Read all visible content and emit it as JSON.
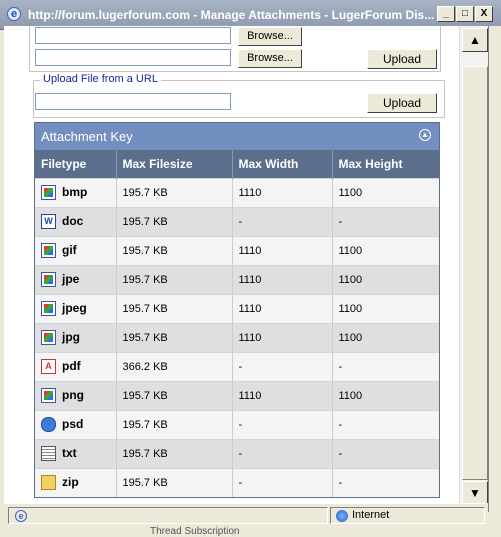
{
  "window": {
    "title": "http://forum.lugerforum.com - Manage Attachments - LugerForum Dis...",
    "controls": [
      "_",
      "□",
      "X"
    ]
  },
  "upload": {
    "browse_label": "Browse...",
    "upload_label": "Upload",
    "url_legend": "Upload File from a URL",
    "url_upload_label": "Upload"
  },
  "attachment_key": {
    "title": "Attachment Key",
    "columns": [
      "Filetype",
      "Max Filesize",
      "Max Width",
      "Max Height"
    ],
    "rows": [
      {
        "ext": "bmp",
        "icon": "image-file-icon",
        "size": "195.7 KB",
        "width": "1110",
        "height": "1100"
      },
      {
        "ext": "doc",
        "icon": "word-doc-icon",
        "size": "195.7 KB",
        "width": "-",
        "height": "-"
      },
      {
        "ext": "gif",
        "icon": "image-file-icon",
        "size": "195.7 KB",
        "width": "1110",
        "height": "1100"
      },
      {
        "ext": "jpe",
        "icon": "image-file-icon",
        "size": "195.7 KB",
        "width": "1110",
        "height": "1100"
      },
      {
        "ext": "jpeg",
        "icon": "image-file-icon",
        "size": "195.7 KB",
        "width": "1110",
        "height": "1100"
      },
      {
        "ext": "jpg",
        "icon": "image-file-icon",
        "size": "195.7 KB",
        "width": "1110",
        "height": "1100"
      },
      {
        "ext": "pdf",
        "icon": "pdf-file-icon",
        "size": "366.2 KB",
        "width": "-",
        "height": "-"
      },
      {
        "ext": "png",
        "icon": "image-file-icon",
        "size": "195.7 KB",
        "width": "1110",
        "height": "1100"
      },
      {
        "ext": "psd",
        "icon": "psd-file-icon",
        "size": "195.7 KB",
        "width": "-",
        "height": "-"
      },
      {
        "ext": "txt",
        "icon": "text-file-icon",
        "size": "195.7 KB",
        "width": "-",
        "height": "-"
      },
      {
        "ext": "zip",
        "icon": "zip-file-icon",
        "size": "195.7 KB",
        "width": "-",
        "height": "-"
      }
    ]
  },
  "status": {
    "zone": "Internet"
  },
  "behind_text": "Thread Subscription",
  "colors": {
    "header_bar": "#738fbf",
    "column_header": "#5b6e8c",
    "title_bar": "#a9b3c6"
  }
}
